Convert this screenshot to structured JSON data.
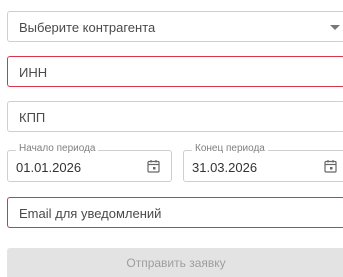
{
  "form": {
    "counterparty_select": {
      "placeholder": "Выберите контрагента",
      "icon": "chevron-down-icon"
    },
    "inn_field": {
      "placeholder": "ИНН",
      "invalid": true
    },
    "kpp_field": {
      "placeholder": "КПП",
      "invalid": false
    },
    "period_start": {
      "label": "Начало периода",
      "value": "01.01.2026",
      "icon": "calendar-icon"
    },
    "period_end": {
      "label": "Конец периода",
      "value": "31.03.2026",
      "icon": "calendar-icon"
    },
    "email_field": {
      "placeholder": "Email для уведомлений",
      "invalid": true
    },
    "submit_button": {
      "label": "Отправить заявку",
      "disabled": true
    }
  },
  "colors": {
    "error_border": "#d8344a",
    "default_border": "#cfcfcf",
    "disabled_button_bg": "#e3e3e3",
    "disabled_button_text": "#9e9e9e"
  }
}
